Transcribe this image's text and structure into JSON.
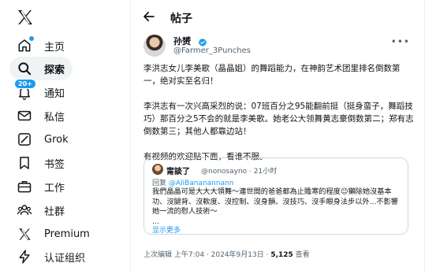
{
  "sidebar": {
    "items": [
      {
        "label": "主页",
        "icon": "home-icon"
      },
      {
        "label": "探索",
        "icon": "search-icon"
      },
      {
        "label": "通知",
        "icon": "bell-icon",
        "badge": "20+"
      },
      {
        "label": "私信",
        "icon": "mail-icon"
      },
      {
        "label": "Grok",
        "icon": "grok-icon"
      },
      {
        "label": "书签",
        "icon": "bookmark-icon"
      },
      {
        "label": "工作",
        "icon": "briefcase-icon"
      },
      {
        "label": "社群",
        "icon": "people-icon"
      },
      {
        "label": "Premium",
        "icon": "x-logo-icon"
      },
      {
        "label": "认证组织",
        "icon": "lightning-icon"
      }
    ]
  },
  "header": {
    "title": "帖子"
  },
  "post": {
    "author": "孙赟",
    "handle": "@Farmer_3Punches",
    "paragraphs": [
      "李洪志女儿李美歌（晶晶姐）的舞蹈能力，在神韵艺术团里排名倒数第一，绝对实至名归！",
      "李洪志有一次兴高采烈的说：07班百分之95能翻前挺（挺身蛮子，舞蹈技巧）那百分之5不会的就是李美歌。她老公大领舞黄志豪倒数第二；郑有志倒数第三；其他人都靠边站！",
      "有视频的欢迎贴下面，看谁不服。"
    ],
    "quote": {
      "name": "甯談了",
      "handle": "@nonosayno · 21小时",
      "reply_prefix": "回复 ",
      "reply_handle": "@AliBananannann",
      "text": "我們晶晶可是大大大領舞～連世間的爸爸都為止贍寒的程度😉獺除她沒基本功、沒腿背、沒軟度、沒控制、沒身韻、沒技巧、沒手眼身法步以外...不影響她一流的慰人技術～\n...",
      "show_more": "显示更多"
    },
    "meta_prefix": "上次编辑 上午7:04 · 2024年9月13日 · ",
    "views": "5,125",
    "views_label": " 查看"
  }
}
